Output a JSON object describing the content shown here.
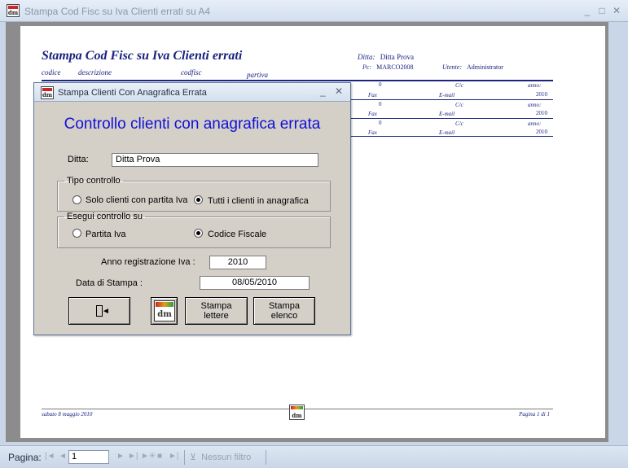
{
  "window": {
    "title": "Stampa Cod Fisc su Iva Clienti errati su A4",
    "app_icon_text": "dm",
    "controls": {
      "minimize": "_",
      "maximize": "□",
      "close": "✕"
    }
  },
  "report": {
    "title": "Stampa Cod Fisc su Iva Clienti errati",
    "columns": [
      "codice",
      "descrizione",
      "codfisc",
      "partiva"
    ],
    "ditta_label": "Ditta:",
    "ditta_value": "Ditta Prova",
    "pc_label": "Pc:",
    "pc_value": "MARCO2008",
    "utente_label": "Utente:",
    "utente_value": "Administrator",
    "rows": [
      {
        "value": "0",
        "cc": "C/c",
        "anno_label": "anno:",
        "fax": "Fax",
        "email": "E-mail",
        "year": "2010"
      },
      {
        "value": "0",
        "cc": "C/c",
        "anno_label": "anno:",
        "fax": "Fax",
        "email": "E-mail",
        "year": "2010"
      },
      {
        "value": "0",
        "cc": "C/c",
        "anno_label": "anno:",
        "fax": "Fax",
        "email": "E-mail",
        "year": "2010"
      }
    ],
    "footer_date": "sabato 8 maggio 2010",
    "footer_page": "Pagina 1 di 1"
  },
  "statusbar": {
    "label": "Pagina:",
    "nav_first": "|◄",
    "nav_prev": "◄",
    "page_value": "1",
    "nav_next": "►",
    "nav_last": "►|",
    "nav_new": "►✳",
    "nav_stop": "■",
    "nav_end": "►|",
    "filter_icon": "funnel-icon",
    "filter_label": "Nessun filtro"
  },
  "dialog": {
    "title": "Stampa Clienti Con Anagrafica Errata",
    "heading": "Controllo clienti con anagrafica errata",
    "controls": {
      "minimize": "_",
      "close": "✕"
    },
    "ditta_label": "Ditta:",
    "ditta_value": "Ditta Prova",
    "tipo_controllo": {
      "legend": "Tipo controllo",
      "options": [
        {
          "label": "Solo clienti con partita Iva",
          "selected": false
        },
        {
          "label": "Tutti i clienti in anagrafica",
          "selected": true
        }
      ]
    },
    "esegui_controllo": {
      "legend": "Esegui controllo su",
      "options": [
        {
          "label": "Partita Iva",
          "selected": false
        },
        {
          "label": "Codice Fiscale",
          "selected": true
        }
      ]
    },
    "anno_label": "Anno registrazione Iva :",
    "anno_value": "2010",
    "data_label": "Data di Stampa :",
    "data_value": "08/05/2010",
    "buttons": {
      "exit_icon": "exit-door-icon",
      "logo_text": "dm",
      "stampa_lettere": [
        "Stampa",
        "lettere"
      ],
      "stampa_elenco": [
        "Stampa",
        "elenco"
      ]
    }
  },
  "colors": {
    "heading_blue": "#1010d8",
    "report_navy": "#1a237e",
    "dialog_bg": "#d4d0c8",
    "report_gray": "#8c8c8c"
  }
}
